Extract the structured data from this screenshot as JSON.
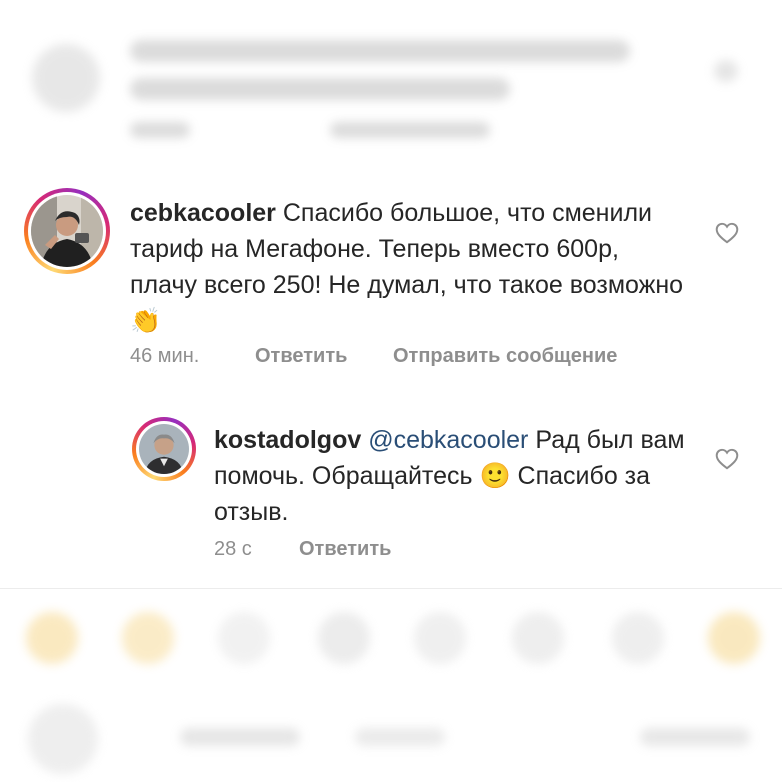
{
  "comments": [
    {
      "username": "cebkacooler",
      "text": "Спасибо большое, что сменили тариф на Мегафоне. Теперь вместо 600р, плачу всего 250! Не думал, что такое возможно👏",
      "time": "46 мин.",
      "reply_label": "Ответить",
      "message_label": "Отправить сообщение"
    }
  ],
  "replies": [
    {
      "username": "kostadolgov",
      "mention": "@cebkacooler",
      "text": "Рад был вам помочь. Обращайтесь 🙂 Спасибо за отзыв.",
      "time": "28 с",
      "reply_label": "Ответить"
    }
  ],
  "icons": {
    "like": "heart-outline-icon",
    "emoji_bar": [
      "heart-eyes-emoji",
      "clap-emoji",
      "fire-emoji",
      "hands-emoji",
      "crying-laughing-emoji",
      "party-emoji",
      "surprised-emoji",
      "smiling-emoji"
    ]
  },
  "colors": {
    "text": "#262626",
    "secondary": "#8e8e8e",
    "mention": "#2a4e76"
  }
}
